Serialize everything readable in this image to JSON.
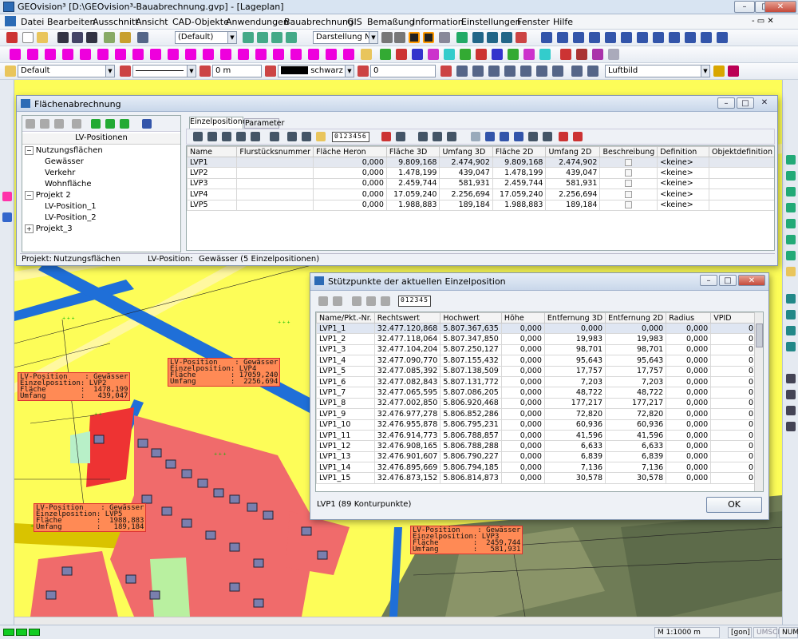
{
  "app": {
    "title": "GEOvision³  [D:\\GEOvision³-Bauabrechnung.gvp] - [Lageplan]",
    "min": "–",
    "max": "□",
    "close": "✕"
  },
  "menu": [
    "Datei",
    "Bearbeiten",
    "Ausschnitt",
    "Ansicht",
    "CAD-Objekte",
    "Anwendungen",
    "Bauabrechnung",
    "GIS",
    "Bemaßung",
    "Information",
    "Einstellungen",
    "Fenster",
    "Hilfe"
  ],
  "toolbar": {
    "style": "(Default)",
    "darstellung": "Darstellung Nut",
    "layer": "Default",
    "length": "0 m",
    "color": "schwarz",
    "number": "0",
    "background": "Luftbild"
  },
  "colors": {
    "map_yellow": "#fdfd58",
    "road_blue": "#1f6fd8",
    "parcel_red": "#f06b6b",
    "label_fill": "#ff8a55"
  },
  "dlg1": {
    "title": "Flächenabrechnung",
    "tree_header": "LV-Positionen",
    "tree": [
      {
        "label": "Nutzungsflächen",
        "lvl": 0,
        "sign": "−"
      },
      {
        "label": "Gewässer",
        "lvl": 1
      },
      {
        "label": "Verkehr",
        "lvl": 1
      },
      {
        "label": "Wohnfläche",
        "lvl": 1
      },
      {
        "label": "Projekt 2",
        "lvl": 0,
        "sign": "−"
      },
      {
        "label": "LV-Position_1",
        "lvl": 1
      },
      {
        "label": "LV-Position_2",
        "lvl": 1
      },
      {
        "label": "Projekt_3",
        "lvl": 0,
        "sign": "+"
      }
    ],
    "tabs": [
      "Einzelpositionen",
      "Parameter"
    ],
    "digits": "0123456",
    "columns": [
      "Name",
      "Flurstücksnummer",
      "Fläche Heron",
      "Fläche 3D",
      "Umfang 3D",
      "Fläche 2D",
      "Umfang 2D",
      "Beschreibung",
      "Definition",
      "Objektdefinition"
    ],
    "rows": [
      [
        "LVP1",
        "",
        "0,000",
        "9.809,168",
        "2.474,902",
        "9.809,168",
        "2.474,902",
        "",
        "<keine>",
        ""
      ],
      [
        "LVP2",
        "",
        "0,000",
        "1.478,199",
        "439,047",
        "1.478,199",
        "439,047",
        "",
        "<keine>",
        ""
      ],
      [
        "LVP3",
        "",
        "0,000",
        "2.459,744",
        "581,931",
        "2.459,744",
        "581,931",
        "",
        "<keine>",
        ""
      ],
      [
        "LVP4",
        "",
        "0,000",
        "17.059,240",
        "2.256,694",
        "17.059,240",
        "2.256,694",
        "",
        "<keine>",
        ""
      ],
      [
        "LVP5",
        "",
        "0,000",
        "1.988,883",
        "189,184",
        "1.988,883",
        "189,184",
        "",
        "<keine>",
        ""
      ]
    ],
    "status_projekt_label": "Projekt:",
    "status_projekt": "Nutzungsflächen",
    "status_lv_label": "LV-Position:",
    "status_lv": "Gewässer (5 Einzelpositionen)"
  },
  "dlg2": {
    "title": "Stützpunkte der aktuellen Einzelposition",
    "digits": "012345",
    "columns": [
      "Name/Pkt.-Nr.",
      "Rechtswert",
      "Hochwert",
      "Höhe",
      "Entfernung 3D",
      "Entfernung 2D",
      "Radius",
      "VPID"
    ],
    "rows": [
      [
        "LVP1_1",
        "32.477.120,868",
        "5.807.367,635",
        "0,000",
        "0,000",
        "0,000",
        "0,000",
        "0"
      ],
      [
        "LVP1_2",
        "32.477.118,064",
        "5.807.347,850",
        "0,000",
        "19,983",
        "19,983",
        "0,000",
        "0"
      ],
      [
        "LVP1_3",
        "32.477.104,204",
        "5.807.250,127",
        "0,000",
        "98,701",
        "98,701",
        "0,000",
        "0"
      ],
      [
        "LVP1_4",
        "32.477.090,770",
        "5.807.155,432",
        "0,000",
        "95,643",
        "95,643",
        "0,000",
        "0"
      ],
      [
        "LVP1_5",
        "32.477.085,392",
        "5.807.138,509",
        "0,000",
        "17,757",
        "17,757",
        "0,000",
        "0"
      ],
      [
        "LVP1_6",
        "32.477.082,843",
        "5.807.131,772",
        "0,000",
        "7,203",
        "7,203",
        "0,000",
        "0"
      ],
      [
        "LVP1_7",
        "32.477.065,595",
        "5.807.086,205",
        "0,000",
        "48,722",
        "48,722",
        "0,000",
        "0"
      ],
      [
        "LVP1_8",
        "32.477.002,850",
        "5.806.920,468",
        "0,000",
        "177,217",
        "177,217",
        "0,000",
        "0"
      ],
      [
        "LVP1_9",
        "32.476.977,278",
        "5.806.852,286",
        "0,000",
        "72,820",
        "72,820",
        "0,000",
        "0"
      ],
      [
        "LVP1_10",
        "32.476.955,878",
        "5.806.795,231",
        "0,000",
        "60,936",
        "60,936",
        "0,000",
        "0"
      ],
      [
        "LVP1_11",
        "32.476.914,773",
        "5.806.788,857",
        "0,000",
        "41,596",
        "41,596",
        "0,000",
        "0"
      ],
      [
        "LVP1_12",
        "32.476.908,165",
        "5.806.788,288",
        "0,000",
        "6,633",
        "6,633",
        "0,000",
        "0"
      ],
      [
        "LVP1_13",
        "32.476.901,607",
        "5.806.790,227",
        "0,000",
        "6,839",
        "6,839",
        "0,000",
        "0"
      ],
      [
        "LVP1_14",
        "32.476.895,669",
        "5.806.794,185",
        "0,000",
        "7,136",
        "7,136",
        "0,000",
        "0"
      ],
      [
        "LVP1_15",
        "32.476.873,152",
        "5.806.814,873",
        "0,000",
        "30,578",
        "30,578",
        "0,000",
        "0"
      ]
    ],
    "footer": "LVP1 (89 Konturpunkte)",
    "ok": "OK"
  },
  "map_labels": [
    {
      "l1": "LV-Position    : Gewässer",
      "l2": "Einzelposition: LVP2",
      "l3": "Fläche        :  1478,199",
      "l4": "Umfang        :   439,047"
    },
    {
      "l1": "LV-Position    : Gewässer",
      "l2": "Einzelposition: LVP4",
      "l3": "Fläche        : 17059,240",
      "l4": "Umfang        :  2256,694"
    },
    {
      "l1": "LV-Position    : Gewässer",
      "l2": "Einzelposition: LVP5",
      "l3": "Fläche        :  1988,883",
      "l4": "Umfang        :   189,184"
    },
    {
      "l1": "LV-Position    : Gewässer",
      "l2": "Einzelposition: LVP3",
      "l3": "Fläche        :  2459,744",
      "l4": "Umfang        :   581,931"
    }
  ],
  "status": {
    "scale": "M 1:1000  m",
    "unit": "[gon]",
    "umsch": "UMSCH",
    "num": "NUM"
  }
}
